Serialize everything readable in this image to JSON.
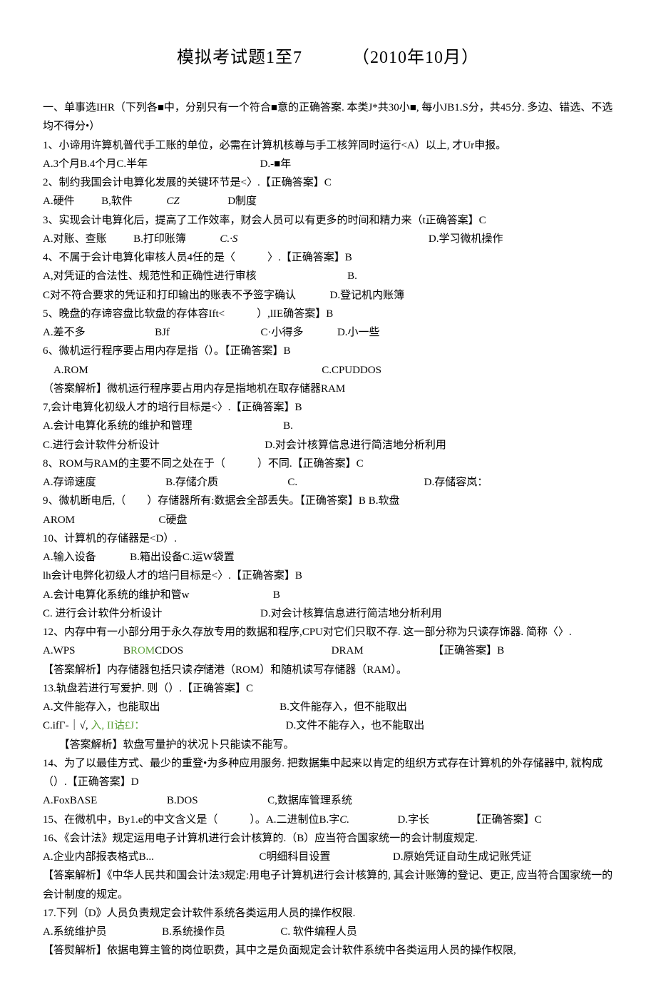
{
  "title_left": "模拟考试题1至7",
  "title_right": "（2010年10月）",
  "intro": "一、单事选IHR（下列各■中，分别只有一个符合■意的正确答案. 本类J*共30小■, 每小JB1.S分，共45分. 多边、错选、不选均不得分•）",
  "q1": "1、小谛用许算机普代手工账的单位，必需在计算机核尊与手工核笄同时运行<A）以上, 才Ur申报。",
  "q1_opts": "A.3个月B.4个月C.半年",
  "q1_d": "D.-■年",
  "q2": "2、制约我国会计电算化发展的关键环节是<〉.【正确答案】C",
  "q2_a": "A.硬件",
  "q2_b": "B,软件",
  "q2_cz": "CZ",
  "q2_d": "D制度",
  "q3": "3、实现会计电算化后，提高了工作效率，财会人员可以有更多的时间和精力来（t正确答案】C",
  "q3_a": "A.对账、查账",
  "q3_b": "B.打印账簿",
  "q3_c": "C.·S",
  "q3_d": "D.学习微机操作",
  "q4": "4、不属于会计电算化审核人员4任的是〈　　　〉.【正确答案】B",
  "q4_a": "A,对凭证的合法性、规范性和正确性进行审核",
  "q4_b": "B.",
  "q4_c": "C对不符合要求的凭证和打印输出的账表不予签字确认",
  "q4_d": "D.登记机内账簿",
  "q5": "5、晚盘的存谛容盘比软盘的存体容Ift<　　　）,lIE确答案】B",
  "q5_a": "A.差不多",
  "q5_b": "BJf",
  "q5_c": "C·小得多",
  "q5_d": "D.小一些",
  "q6": "6、微机运行程序要占用内存是指（）。【正确答案】B",
  "q6_a": "A.ROM",
  "q6_c": "C.CPUDDOS",
  "q6_exp": "（答案解析】微机运行程序要占用内存是指地机在取存储器RAM",
  "q7": "7,会计电算化初级人才的培行目标是<〉.【正确答案】B",
  "q7_a": "A.会计电算化系统的维护和管理",
  "q7_b": "B.",
  "q7_c": "C.进行会计软件分析设计",
  "q7_d": "D.对会计核算信息进行简洁地分析利用",
  "q8": "8、ROM与RAM的主要不同之处在于（　　　）不同.【正确答案】C",
  "q8_a": "A.存谛速度",
  "q8_b": "B.存储介质",
  "q8_c": "C.",
  "q8_d": "D.存储容岚：",
  "q9": "9、微机断电后,（　　）存储器所有:数据会全部丢失。【正确答案】B",
  "q9_b": "B.软盘",
  "q9_arom": "AROM",
  "q9_c": "C硬盘",
  "q10": "10、计算机的存储器是<D）.",
  "q10_a": "A.输入设备",
  "q10_b": "B.箱出设备C.运W袋置",
  "q11": "lh会计电弊化初级人才的培闩目标是<〉.【正确答案】B",
  "q11_a": "A.会计电算化系统的维护和管w",
  "q11_b": "B",
  "q11_c": "C. 进行会计软件分析设计",
  "q11_d": "D.对会计核算信息进行简洁地分析利用",
  "q12": "12、内存中有一小部分用于永久存放专用的数据和程序,CPU对它们只取不存. 这一部分称为只读存饰器. 简称〈〉.",
  "q12_a": "A.WPS",
  "q12_b_pre": "B",
  "q12_b_rom": "ROM",
  "q12_b_post": "CDOS",
  "q12_dram": "DRAM",
  "q12_ans": "【正确答案】B",
  "q12_exp": "【答案解析】内存储器包括只读",
  "q12_exp_mid": "存",
  "q12_exp_post": "储港（ROM）和随机读写存储器（RAM）。",
  "q13": "13.轨盘若进行写爱护. 则（）.【正确答案】C",
  "q13_a": "A.文件能存入，也能取出",
  "q13_b": "B.文件能存入，但不能取出",
  "q13_c_pre": "C.ifΓ-｜√,",
  "q13_c_mid": "入, II诂£J：",
  "q13_d": "D.文件不能存入，也不能取出",
  "q13_exp": "　　【答案解析】软盘写量护的状况卜只能读不能写。",
  "q14": "14、为了以最佳方式、最少的重登•为多种应用服务. 把数据集中起来以肯定的组织方式存在计算机的外存储器中, 就构成（）.【正确答案】D",
  "q14_a": "A.FoxBΛSE",
  "q14_b": "B.DOS",
  "q14_c": "C,数据库管理系统",
  "q15": "15、在微机中，By1.e的中文含义是（　　　）。A.二进制位B.字",
  "q15_c": "C.",
  "q15_d": "D.字长",
  "q15_ans": "【正确答案】C",
  "q16": "16、《会计法》规定运用电子计算机进行会计核算的.（B）应当符合国家统一的会计制度规定.",
  "q16_a": "A.企业内部报表格式B...",
  "q16_c": "C明细科目设置",
  "q16_d": "D.原始凭证自动生成记账凭证",
  "q16_exp": "【答案解析】《中华人民共和国会计法3规定:用电子计算机进行会计核算的, 其会计账簿的登记、更正, 应当符合国家统一的会计制度的规定。",
  "q17": "17.下列（D》人员负责规定会计软件系统各类运用人员的操作权限.",
  "q17_a": "A.系统维护员",
  "q17_b": "B.系统操作员",
  "q17_c": "C. 软件编程人员",
  "q17_exp": "【答熨解析】依据电算主管的岗位职费，其中之是负面规定会计软件系统中各类运用人员的操作权限,"
}
